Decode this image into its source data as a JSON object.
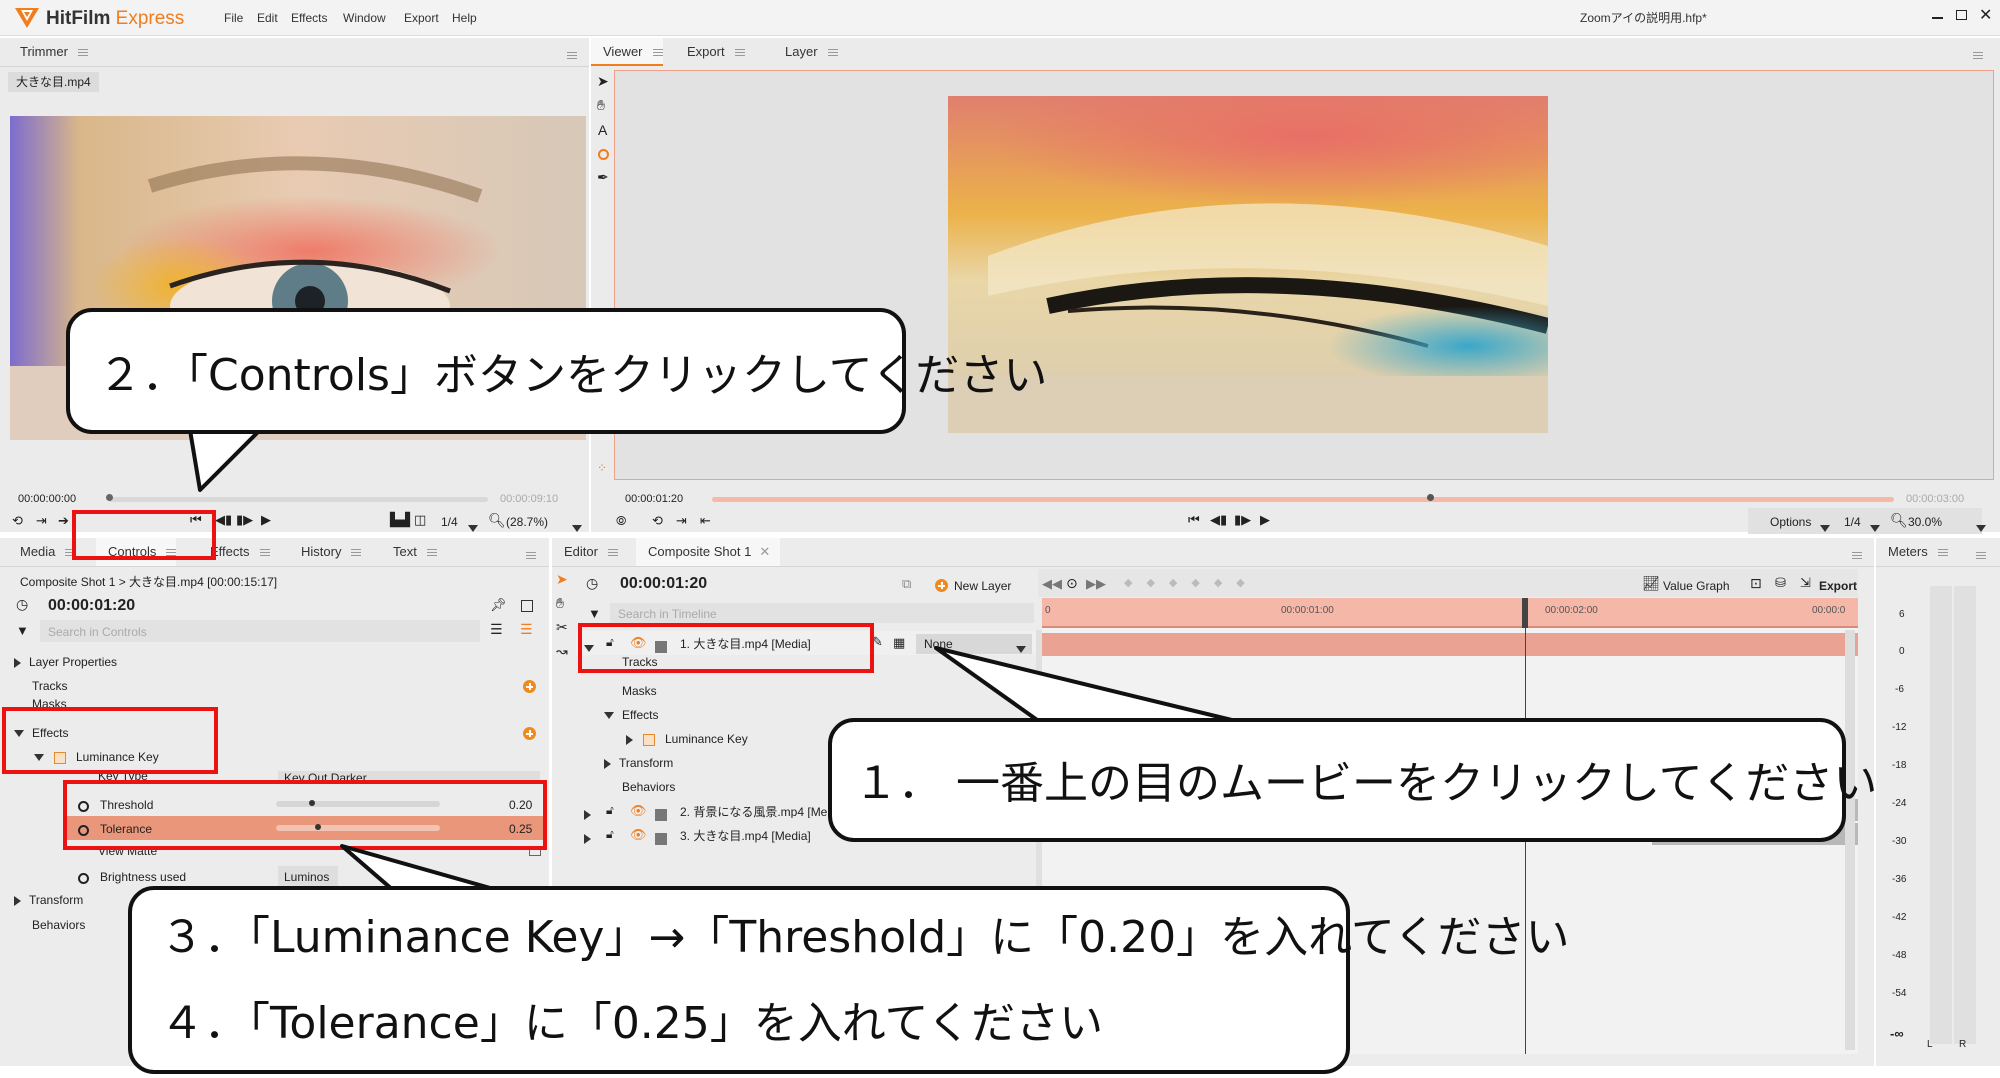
{
  "app": {
    "brand_a": "HitFilm",
    "brand_b": "Express",
    "menu": [
      "File",
      "Edit",
      "Effects",
      "Window",
      "Export",
      "Help"
    ],
    "project_title": "Zoomアイの説明用.hfp*"
  },
  "trimmer": {
    "tab": "Trimmer",
    "file_tab": "大きな目.mp4",
    "time_start": "00:00:00:00",
    "time_end": "00:00:09:10",
    "quality": "1/4",
    "zoom": "(28.7%)"
  },
  "viewer": {
    "tabs": [
      "Viewer",
      "Export",
      "Layer"
    ],
    "time_current": "00:00:01:20",
    "time_end": "00:00:03:00",
    "options": "Options",
    "quality": "1/4",
    "zoom": "30.0%"
  },
  "controls_panel": {
    "tabs": [
      "Media",
      "Controls",
      "Effects",
      "History",
      "Text"
    ],
    "breadcrumb": "Composite Shot 1 > 大きな目.mp4 [00:00:15:17]",
    "timecode": "00:00:01:20",
    "search_placeholder": "Search in Controls",
    "rows": {
      "layer_properties": "Layer Properties",
      "tracks": "Tracks",
      "masks": "Masks",
      "effects": "Effects",
      "luminance_key": "Luminance Key",
      "key_type": "Key Type",
      "key_type_value": "Key Out Darker",
      "threshold": "Threshold",
      "threshold_value": "0.20",
      "tolerance": "Tolerance",
      "tolerance_value": "0.25",
      "view_matte": "View Matte",
      "brightness_used": "Brightness used",
      "brightness_value": "Luminos",
      "transform": "Transform",
      "behaviors": "Behaviors"
    },
    "threshold_level": 0.2,
    "tolerance_level": 0.25
  },
  "editor": {
    "tabs": [
      "Editor",
      "Composite Shot 1"
    ],
    "timecode": "00:00:01:20",
    "new_layer": "New Layer",
    "value_graph": "Value Graph",
    "export": "Export",
    "search_placeholder": "Search in Timeline",
    "ruler": [
      "0",
      "00:00:01:00",
      "00:00:02:00",
      "00:00:0"
    ],
    "layers": {
      "layer1": "1. 大きな目.mp4 [Media]",
      "blend": "None",
      "tracks": "Tracks",
      "masks": "Masks",
      "effects": "Effects",
      "luminance_key": "Luminance Key",
      "transform": "Transform",
      "behaviors": "Behaviors",
      "layer2": "2. 背景になる風景.mp4 [Me",
      "layer3": "3. 大きな目.mp4 [Media]"
    }
  },
  "meters": {
    "tab": "Meters",
    "scale": [
      "6",
      "0",
      "-6",
      "-12",
      "-18",
      "-24",
      "-30",
      "-36",
      "-42",
      "-48",
      "-54",
      "-∞"
    ],
    "channels": [
      "L",
      "R"
    ]
  },
  "callouts": {
    "step1": "１．  一番上の目のムービーをクリックしてください",
    "step2": "２．「Controls」ボタンをクリックしてください",
    "step3": "３．「Luminance Key」→「Threshold」に「0.20」を入れてください",
    "step4": "４．「Tolerance」に「0.25」を入れてください"
  },
  "colors": {
    "brand_orange": "#f07d1e",
    "annotation_red": "#ee1111",
    "selection_salmon": "#e9967a",
    "timeline_salmon": "#f4b7a8"
  }
}
